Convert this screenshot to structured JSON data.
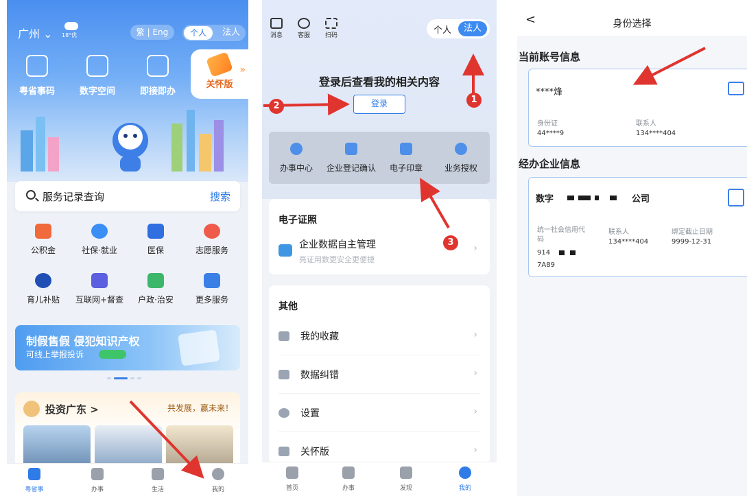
{
  "panel1": {
    "city": "广州",
    "city_chevron": "⌄",
    "weather_temp": "18°优",
    "lang_switch": "繁 | Eng",
    "mode_personal": "个人",
    "mode_corporate": "法人",
    "quick_entries": [
      "粤省事码",
      "数字空间",
      "即接即办"
    ],
    "care_label": "关怀版",
    "care_arrow": "»",
    "search_text": "服务记录查询",
    "search_button": "搜索",
    "services": [
      {
        "label": "公积金",
        "icon": "house-fund-icon",
        "color": "#f06a3c"
      },
      {
        "label": "社保·就业",
        "icon": "social-security-icon",
        "color": "#3a8ef5"
      },
      {
        "label": "医保",
        "icon": "medical-insurance-icon",
        "color": "#2f6fe0"
      },
      {
        "label": "志愿服务",
        "icon": "volunteer-heart-icon",
        "color": "#f05a4a"
      },
      {
        "label": "育儿补贴",
        "icon": "childcare-icon",
        "color": "#1f4fb5"
      },
      {
        "label": "互联网+督查",
        "icon": "inspection-icon",
        "color": "#5b5fe0"
      },
      {
        "label": "户政·治安",
        "icon": "public-security-icon",
        "color": "#3cb76a"
      },
      {
        "label": "更多服务",
        "icon": "more-grid-icon",
        "color": "#3a7fe6"
      }
    ],
    "banner_title": "制假售假 侵犯知识产权",
    "banner_subtitle": "可线上举报投诉",
    "invest_title": "投资广东 >",
    "invest_slogan": "共发展，赢未来！",
    "tabs": [
      "粤省事",
      "办事",
      "生活",
      "我的"
    ]
  },
  "panel2": {
    "top_icons": [
      "消息",
      "客服",
      "扫码"
    ],
    "mode_personal": "个人",
    "mode_corporate": "法人",
    "login_prompt": "登录后查看我的相关内容",
    "login_button": "登录",
    "services": [
      "办事中心",
      "企业登记确认",
      "电子印章",
      "业务授权"
    ],
    "cert_section": "电子证照",
    "cert_item_title": "企业数据自主管理",
    "cert_item_subtitle": "亮证用数更安全更便捷",
    "other_section": "其他",
    "other_items": [
      "我的收藏",
      "数据纠错",
      "设置",
      "关怀版"
    ],
    "tabs": [
      "首页",
      "办事",
      "发现",
      "我的"
    ]
  },
  "panel3": {
    "title": "身份选择",
    "back": "<",
    "account_section": "当前账号信息",
    "account_name": "****烽",
    "id_label": "身份证",
    "id_value": "44****9",
    "contact_label": "联系人",
    "contact_value": "134****404",
    "enterprise_section": "经办企业信息",
    "enterprise_name_prefix": "数字",
    "enterprise_name_suffix": "公司",
    "credit_code_label": "统一社会信用代码",
    "credit_code_value_a": "914",
    "credit_code_value_b": "7A89",
    "ent_contact_label": "联系人",
    "ent_contact_value": "134****404",
    "deadline_label": "绑定截止日期",
    "deadline_value": "9999-12-31"
  },
  "annotations": {
    "badges": [
      "1",
      "2",
      "3"
    ],
    "color": "#e0342f"
  }
}
